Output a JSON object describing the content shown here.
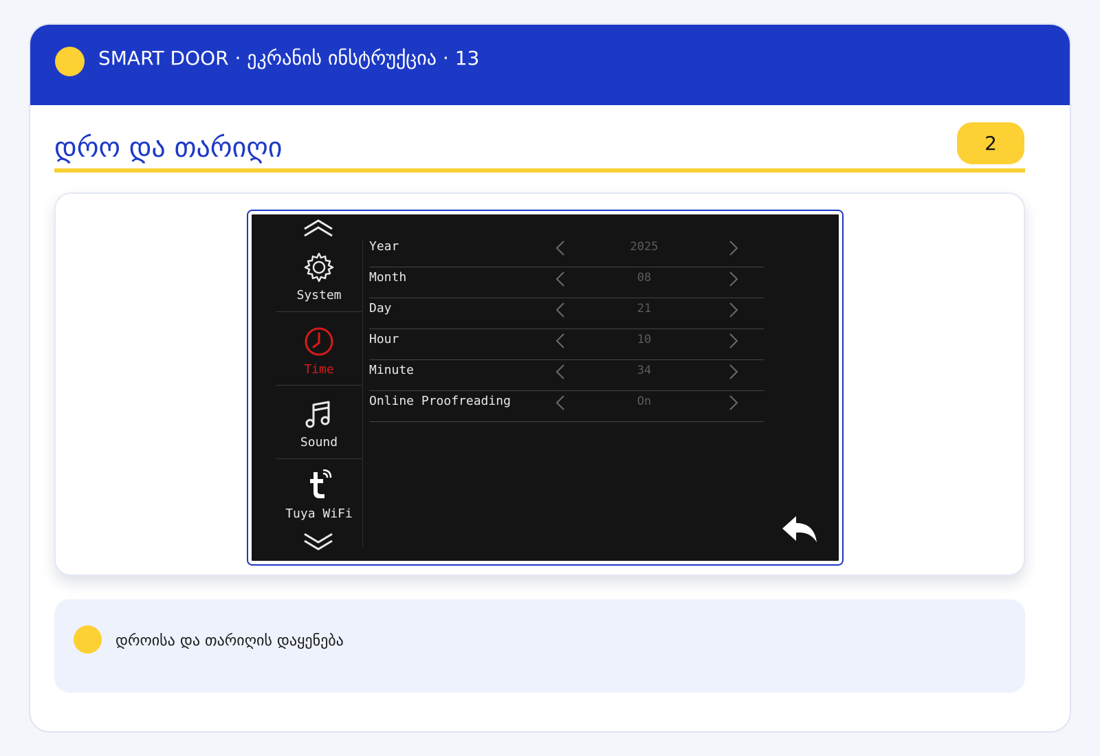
{
  "header": {
    "title": "SMART DOOR · ეკრანის ინსტრუქცია · 13"
  },
  "section": {
    "heading": "დრო და თარიღი",
    "step_number": "2"
  },
  "device": {
    "sidebar": [
      {
        "label": "System",
        "icon": "gear-icon",
        "active": false
      },
      {
        "label": "Time",
        "icon": "clock-icon",
        "active": true
      },
      {
        "label": "Sound",
        "icon": "music-note-icon",
        "active": false
      },
      {
        "label": "Tuya WiFi",
        "icon": "tuya-logo-icon",
        "active": false
      }
    ],
    "settings": [
      {
        "name": "Year",
        "value": "2025"
      },
      {
        "name": "Month",
        "value": "08"
      },
      {
        "name": "Day",
        "value": "21"
      },
      {
        "name": "Hour",
        "value": "10"
      },
      {
        "name": "Minute",
        "value": "34"
      },
      {
        "name": "Online Proofreading",
        "value": "On"
      }
    ],
    "colors": {
      "active": "#d71a1a",
      "text": "#e8e8e8",
      "value": "#5c5c5c",
      "background": "#141414"
    }
  },
  "note": {
    "text": "დროისა და თარიღის დაყენება"
  },
  "colors": {
    "primary": "#1c39c6",
    "accent": "#fdd034"
  }
}
